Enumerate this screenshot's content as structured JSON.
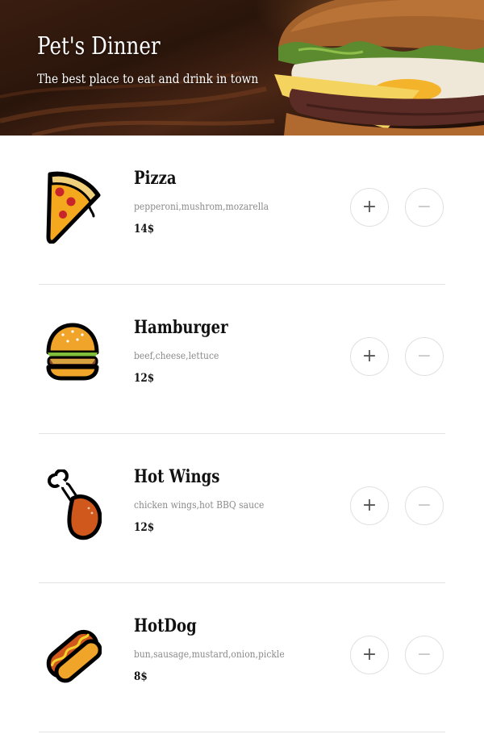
{
  "header": {
    "title": "Pet's Dinner",
    "subtitle": "The best place to eat and drink in town"
  },
  "items": [
    {
      "name": "Pizza",
      "description": "pepperoni,mushrom,mozarella",
      "price": "14$",
      "icon": "pizza-icon",
      "plus": "+",
      "minus": "−"
    },
    {
      "name": "Hamburger",
      "description": "beef,cheese,lettuce",
      "price": "12$",
      "icon": "hamburger-icon",
      "plus": "+",
      "minus": "−"
    },
    {
      "name": "Hot Wings",
      "description": "chicken wings,hot BBQ sauce",
      "price": "12$",
      "icon": "chicken-leg-icon",
      "plus": "+",
      "minus": "−"
    },
    {
      "name": "HotDog",
      "description": "bun,sausage,mustard,onion,pickle",
      "price": "8$",
      "icon": "hotdog-icon",
      "plus": "+",
      "minus": "−"
    }
  ],
  "colors": {
    "pizza_crust": "#f3a81d",
    "pepperoni": "#c8242b",
    "bun": "#f1a42a",
    "patty": "#8b4a2b",
    "lettuce": "#7fbf3a",
    "chicken": "#d0581c",
    "bone": "#ffffff",
    "mustard": "#f5d22a",
    "outline": "#000000",
    "divider": "#e3e3e3"
  }
}
